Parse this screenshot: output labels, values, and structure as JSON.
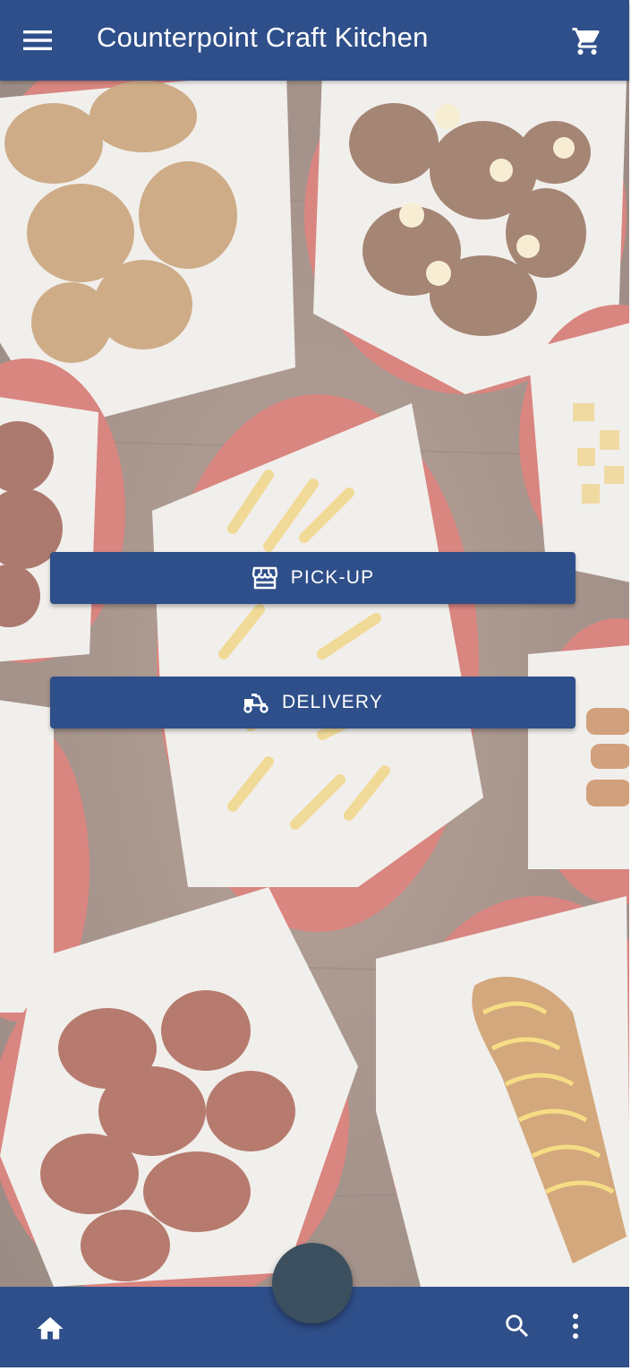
{
  "app_bar": {
    "title": "Counterpoint Craft Kitchen",
    "menu_icon": "menu-icon",
    "cart_icon": "cart-icon"
  },
  "actions": {
    "pickup_label": "PICK-UP",
    "pickup_icon": "storefront-icon",
    "delivery_label": "DELIVERY",
    "delivery_icon": "delivery-scooter-icon"
  },
  "bottom_bar": {
    "home_icon": "home-icon",
    "search_icon": "search-icon",
    "more_icon": "more-vert-icon"
  },
  "colors": {
    "primary": "#2f4f8a",
    "fab": "#3b4f5e",
    "text_on_primary": "#ffffff"
  }
}
